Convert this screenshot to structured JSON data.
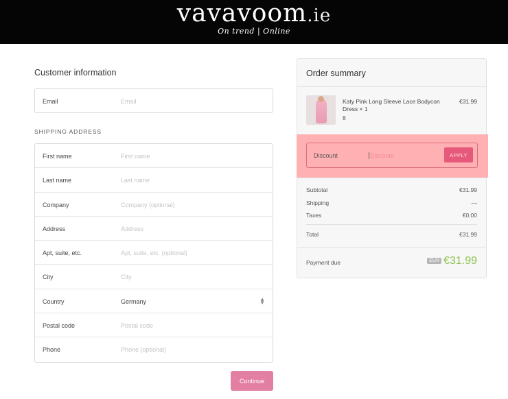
{
  "brand": {
    "logo_main": "vavavoom",
    "logo_suffix": ".ie",
    "tagline": "On trend  |  Online"
  },
  "customer_info": {
    "title": "Customer information",
    "email_label": "Email",
    "email_placeholder": "Email"
  },
  "shipping": {
    "title": "SHIPPING ADDRESS",
    "fields": [
      {
        "label": "First name",
        "placeholder": "First name"
      },
      {
        "label": "Last name",
        "placeholder": "Last name"
      },
      {
        "label": "Company",
        "placeholder": "Company (optional)"
      },
      {
        "label": "Address",
        "placeholder": "Address"
      },
      {
        "label": "Apt, suite, etc.",
        "placeholder": "Apt, suite, etc. (optional)"
      },
      {
        "label": "City",
        "placeholder": "City"
      },
      {
        "label": "Country",
        "value": "Germany"
      },
      {
        "label": "Postal code",
        "placeholder": "Postal code"
      },
      {
        "label": "Phone",
        "placeholder": "Phone (optional)"
      }
    ]
  },
  "continue_label": "Continue",
  "order_summary": {
    "title": "Order summary",
    "product": {
      "name": "Katy Pink Long Sleeve Lace Bodycon Dress × 1",
      "variant": "8",
      "price": "€31.99"
    },
    "discount": {
      "label": "Discount",
      "placeholder": "Discount",
      "apply_label": "APPLY"
    },
    "subtotal_label": "Subtotal",
    "subtotal_value": "€31.99",
    "shipping_label": "Shipping",
    "shipping_value": "—",
    "taxes_label": "Taxes",
    "taxes_value": "€0.00",
    "total_label": "Total",
    "total_value": "€31.99",
    "payment_due_label": "Payment due",
    "currency": "EUR",
    "payment_due_value": "€31.99"
  },
  "colors": {
    "header_bg": "#050505",
    "accent_pink": "#e37fa2",
    "apply_button": "#e7597a",
    "discount_highlight": "#ffb0b3",
    "payment_green": "#8dc351"
  }
}
